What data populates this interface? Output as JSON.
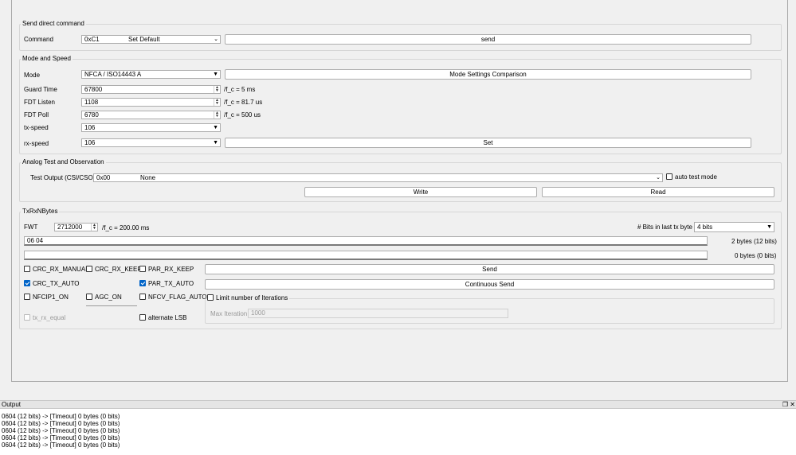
{
  "direct_command": {
    "title": "Send direct command",
    "command_label": "Command",
    "command_code": "0xC1",
    "command_name": "Set Default",
    "send_label": "send"
  },
  "mode_speed": {
    "title": "Mode and Speed",
    "mode_label": "Mode",
    "mode_value": "NFCA / ISO14443 A",
    "mode_compare_label": "Mode Settings Comparison",
    "guard_time_label": "Guard Time",
    "guard_time_value": "67800",
    "guard_time_unit": "/f_c = 5 ms",
    "fdt_listen_label": "FDT Listen",
    "fdt_listen_value": "1108",
    "fdt_listen_unit": "/f_c = 81.7 us",
    "fdt_poll_label": "FDT Poll",
    "fdt_poll_value": "6780",
    "fdt_poll_unit": "/f_c = 500 us",
    "tx_speed_label": "tx-speed",
    "tx_speed_value": "106",
    "rx_speed_label": "rx-speed",
    "rx_speed_value": "106",
    "set_label": "Set"
  },
  "analog": {
    "title": "Analog Test and Observation",
    "test_output_label": "Test Output (CSI/CSO)",
    "test_output_code": "0x00",
    "test_output_name": "None",
    "auto_test_label": "auto test mode",
    "write_label": "Write",
    "read_label": "Read"
  },
  "txrx": {
    "title": "TxRxNBytes",
    "fwt_label": "FWT",
    "fwt_value": "2712000",
    "fwt_unit": "/f_c = 200.00 ms",
    "bits_last_label": "# Bits in last tx byte",
    "bits_last_value": "4 bits",
    "tx_data": "06 04",
    "tx_count": "2 bytes (12 bits)",
    "rx_data": "",
    "rx_count": "0 bytes (0 bits)",
    "crc_rx_manual": "CRC_RX_MANUAL",
    "crc_rx_keep": "CRC_RX_KEEP",
    "par_rx_keep": "PAR_RX_KEEP",
    "crc_tx_auto": "CRC_TX_AUTO",
    "par_tx_auto": "PAR_TX_AUTO",
    "nfcip1_on": "NFCIP1_ON",
    "agc_on": "AGC_ON",
    "nfcv_flag_auto": "NFCV_FLAG_AUTO",
    "tx_rx_equal": "tx_rx_equal",
    "alternate_lsb": "alternate LSB",
    "send_label": "Send",
    "continuous_send_label": "Continuous Send",
    "limit_iter_label": "Limit number of Iterations",
    "max_iter_label": "Max Iteration",
    "max_iter_value": "1000"
  },
  "output": {
    "title": "Output",
    "lines": [
      "0604 (12 bits) -> [Timeout]  0 bytes (0 bits)",
      "0604 (12 bits) -> [Timeout]  0 bytes (0 bits)",
      "0604 (12 bits) -> [Timeout]  0 bytes (0 bits)",
      "0604 (12 bits) -> [Timeout]  0 bytes (0 bits)",
      "0604 (12 bits) -> [Timeout]  0 bytes (0 bits)"
    ]
  }
}
